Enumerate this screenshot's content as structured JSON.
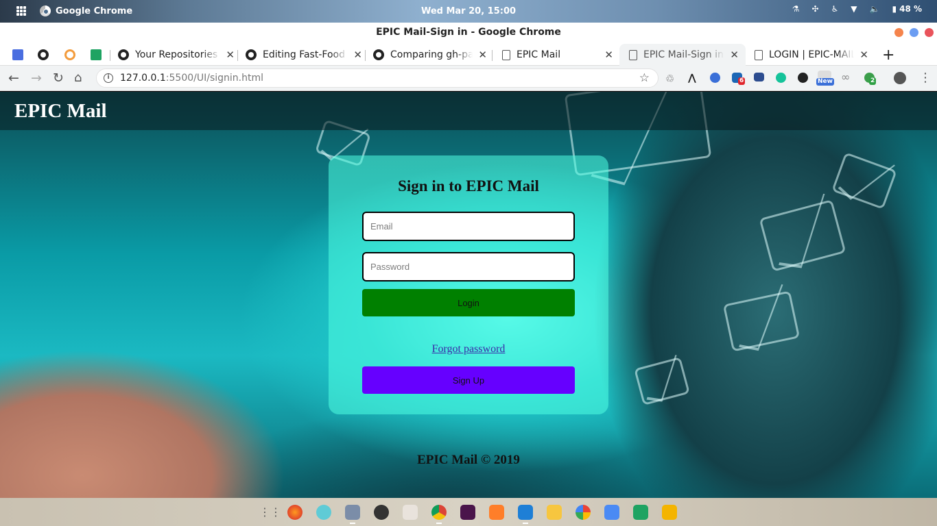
{
  "system_bar": {
    "app_name": "Google Chrome",
    "clock": "Wed Mar 20, 15:00",
    "battery": "48 %"
  },
  "window": {
    "title": "EPIC Mail-Sign in - Google Chrome"
  },
  "tabs": [
    {
      "label": "",
      "icon": "docs-icon"
    },
    {
      "label": "",
      "icon": "github-icon"
    },
    {
      "label": "",
      "icon": "circle-logo-icon"
    },
    {
      "label": "",
      "icon": "sheets-icon"
    },
    {
      "label": "Your Repositories",
      "icon": "github-icon"
    },
    {
      "label": "Editing Fast-Food",
      "icon": "github-icon"
    },
    {
      "label": "Comparing gh-pa",
      "icon": "github-icon"
    },
    {
      "label": "EPIC Mail",
      "icon": "page-icon"
    },
    {
      "label": "EPIC Mail-Sign in",
      "icon": "page-icon",
      "active": true
    },
    {
      "label": "LOGIN | EPIC-MAIL",
      "icon": "page-icon"
    }
  ],
  "address_bar": {
    "host": "127.0.0.1",
    "path": ":5500/UI/signin.html"
  },
  "extensions": {
    "linkedin_badge": "6",
    "new_badge": "New",
    "grammarly_badge": "2"
  },
  "page": {
    "brand": "EPIC Mail",
    "form": {
      "title": "Sign in to EPIC Mail",
      "email_placeholder": "Email",
      "password_placeholder": "Password",
      "login_label": "Login",
      "forgot_label": "Forgot password",
      "signup_label": "Sign Up"
    },
    "footer": "EPIC Mail © 2019"
  },
  "colors": {
    "login_button": "#008000",
    "signup_button": "#6600ff",
    "card": "#50ffe1"
  }
}
